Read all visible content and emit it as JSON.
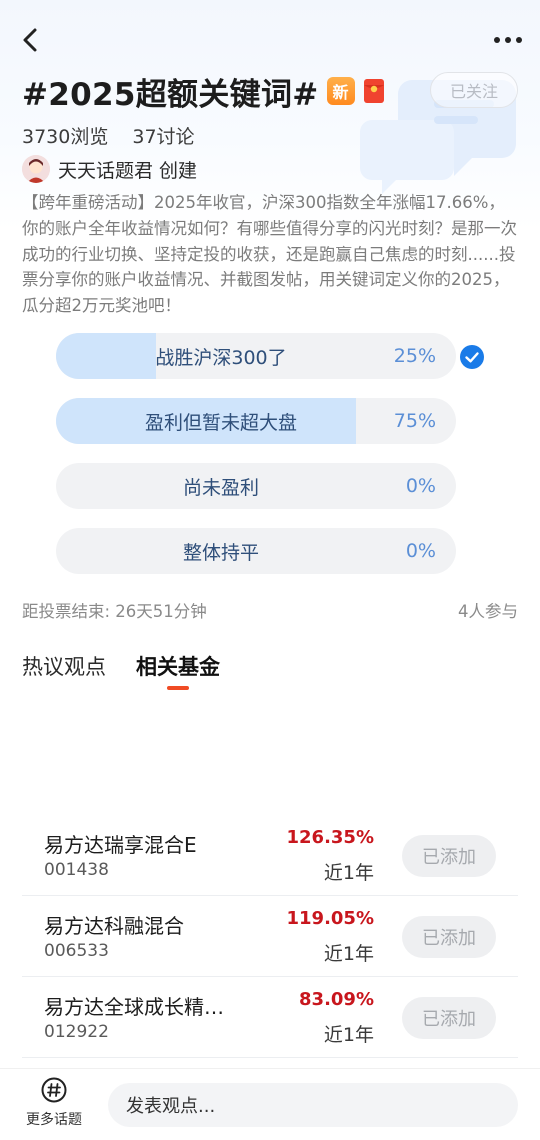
{
  "header": {
    "title": "#2025超额关键词#",
    "new_badge": "新",
    "follow_label": "已关注",
    "icons": {
      "back": "chevron-left-icon",
      "more": "more-dots-icon",
      "redpack": "red-envelope-icon"
    }
  },
  "stats": {
    "views": "3730浏览",
    "discussions": "37讨论"
  },
  "creator": {
    "name": "天天话题君",
    "suffix": "创建"
  },
  "description": "【跨年重磅活动】2025年收官，沪深300指数全年涨幅17.66%，你的账户全年收益情况如何？有哪些值得分享的闪光时刻？是那一次成功的行业切换、坚持定投的收获，还是跑赢自己焦虑的时刻......投票分享你的账户收益情况、并截图发帖，用关键词定义你的2025，瓜分超2万元奖池吧！",
  "poll": {
    "options": [
      {
        "label": "战胜沪深300了",
        "percent": "25%",
        "fraction": 0.25,
        "selected": true
      },
      {
        "label": "盈利但暂未超大盘",
        "percent": "75%",
        "fraction": 0.75,
        "selected": false
      },
      {
        "label": "尚未盈利",
        "percent": "0%",
        "fraction": 0,
        "selected": false
      },
      {
        "label": "整体持平",
        "percent": "0%",
        "fraction": 0,
        "selected": false
      }
    ],
    "deadline": "距投票结束: 26天51分钟",
    "participants": "4人参与"
  },
  "tabs": [
    {
      "label": "热议观点",
      "active": false
    },
    {
      "label": "相关基金",
      "active": true
    }
  ],
  "funds": [
    {
      "name": "易方达瑞享混合E",
      "code": "001438",
      "return": "126.35%",
      "period": "近1年",
      "action": "已添加"
    },
    {
      "name": "易方达科融混合",
      "code": "006533",
      "return": "119.05%",
      "period": "近1年",
      "action": "已添加"
    },
    {
      "name": "易方达全球成长精…",
      "code": "012922",
      "return": "83.09%",
      "period": "近1年",
      "action": "已添加"
    }
  ],
  "bottom": {
    "more_topics": "更多话题",
    "comment_placeholder": "发表观点..."
  },
  "colors": {
    "accent_blue": "#1a7be8",
    "fill_blue": "#cfe4fb",
    "return_red": "#c8161d",
    "tab_underline": "#f04b24",
    "badge_orange": "#ff9a2e"
  }
}
